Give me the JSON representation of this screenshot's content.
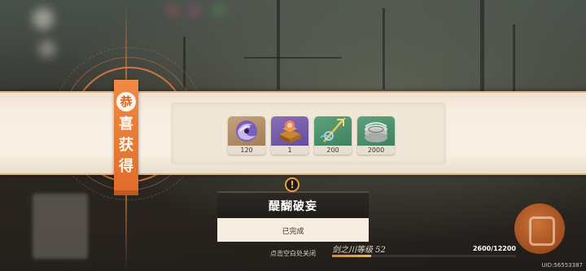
{
  "title": {
    "chars": [
      "恭",
      "喜",
      "获",
      "得"
    ]
  },
  "rewards": [
    {
      "icon": "purple-swirl-orb-icon",
      "count": "120"
    },
    {
      "icon": "treasure-chest-icon",
      "count": "1"
    },
    {
      "icon": "golden-trident-icon",
      "count": "200"
    },
    {
      "icon": "scroll-coins-icon",
      "count": "2000"
    }
  ],
  "quest": {
    "icon": "exclamation-icon",
    "alert_symbol": "!",
    "name": "醍醐破妄",
    "status": "已完成"
  },
  "hint": "点击空白处关闭",
  "level": {
    "label": "剑之川等级 52",
    "exp_text": "2600/12200",
    "exp_fraction": 0.213
  },
  "uid": "UID:56553387",
  "colors": {
    "accent_orange": "#e97d3a",
    "banner_cream": "#f8f0e4",
    "quest_dark": "#1f1c1a"
  }
}
